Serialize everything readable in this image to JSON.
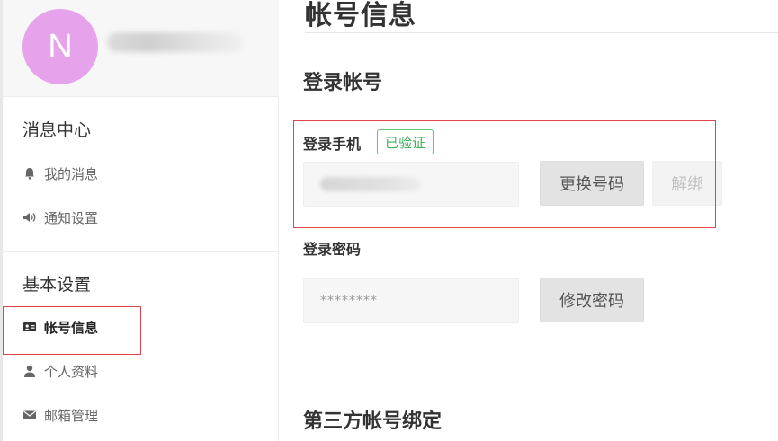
{
  "profile": {
    "avatar_letter": "N",
    "avatar_color": "#e6a3eb"
  },
  "sidebar": {
    "sections": [
      {
        "title": "消息中心",
        "items": [
          {
            "label": "我的消息",
            "icon": "bell-icon",
            "active": false
          },
          {
            "label": "通知设置",
            "icon": "speaker-icon",
            "active": false
          }
        ]
      },
      {
        "title": "基本设置",
        "items": [
          {
            "label": "帐号信息",
            "icon": "id-card-icon",
            "active": true
          },
          {
            "label": "个人资料",
            "icon": "user-icon",
            "active": false
          },
          {
            "label": "邮箱管理",
            "icon": "mail-icon",
            "active": false
          }
        ]
      }
    ]
  },
  "main": {
    "page_title": "帐号信息",
    "login_account": {
      "heading": "登录帐号",
      "phone_label": "登录手机",
      "verified_badge": "已验证",
      "change_button": "更换号码",
      "unbind_button": "解绑",
      "password_label": "登录密码",
      "password_value": "********",
      "change_password_button": "修改密码"
    },
    "third_party": {
      "heading": "第三方帐号绑定"
    }
  },
  "colors": {
    "highlight_border": "#e0474c",
    "verified_green": "#3fae5b"
  }
}
